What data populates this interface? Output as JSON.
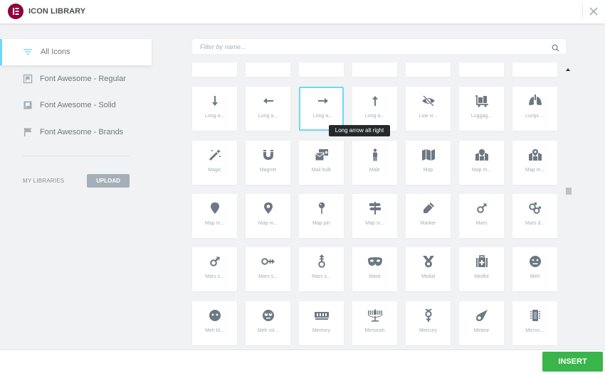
{
  "header": {
    "title": "ICON LIBRARY"
  },
  "sidebar": {
    "items": [
      {
        "label": "All Icons",
        "icon": "list-filter-icon",
        "active": true
      },
      {
        "label": "Font Awesome - Regular",
        "icon": "flag-regular-icon",
        "active": false
      },
      {
        "label": "Font Awesome - Solid",
        "icon": "flag-solid-icon",
        "active": false
      },
      {
        "label": "Font Awesome - Brands",
        "icon": "flag-brands-icon",
        "active": false
      }
    ],
    "my_libraries_label": "MY LIBRARIES",
    "upload_label": "UPLOAD"
  },
  "search": {
    "placeholder": "Filter by name...",
    "value": ""
  },
  "grid": {
    "rows": [
      [
        {
          "label": "Long a...",
          "icon": "long-arrow-down-icon",
          "glyph": "🠗"
        },
        {
          "label": "Long a...",
          "icon": "long-arrow-left-icon",
          "glyph": "🠔"
        },
        {
          "label": "Long a...",
          "icon": "long-arrow-right-icon",
          "glyph": "🠖",
          "selected": true
        },
        {
          "label": "Long a...",
          "icon": "long-arrow-up-icon",
          "glyph": "🠕"
        },
        {
          "label": "Low vi...",
          "icon": "low-vision-icon",
          "glyph": ""
        },
        {
          "label": "Luggag...",
          "icon": "luggage-cart-icon",
          "glyph": ""
        },
        {
          "label": "Lungs ...",
          "icon": "lungs-virus-icon",
          "glyph": ""
        }
      ],
      [
        {
          "label": "Magic",
          "icon": "magic-wand-icon",
          "glyph": ""
        },
        {
          "label": "Magnet",
          "icon": "magnet-icon",
          "glyph": ""
        },
        {
          "label": "Mail bulk",
          "icon": "mail-bulk-icon",
          "glyph": ""
        },
        {
          "label": "Male",
          "icon": "male-icon",
          "glyph": ""
        },
        {
          "label": "Map",
          "icon": "map-icon",
          "glyph": ""
        },
        {
          "label": "Map m...",
          "icon": "map-marked-icon",
          "glyph": ""
        },
        {
          "label": "Map m...",
          "icon": "map-marked-alt-icon",
          "glyph": ""
        }
      ],
      [
        {
          "label": "Map m...",
          "icon": "map-marker-icon",
          "glyph": ""
        },
        {
          "label": "Map m...",
          "icon": "map-marker-alt-icon",
          "glyph": ""
        },
        {
          "label": "Map pin",
          "icon": "map-pin-icon",
          "glyph": ""
        },
        {
          "label": "Map si...",
          "icon": "map-signs-icon",
          "glyph": ""
        },
        {
          "label": "Marker",
          "icon": "marker-icon",
          "glyph": ""
        },
        {
          "label": "Mars",
          "icon": "mars-icon",
          "glyph": "♂"
        },
        {
          "label": "Mars d...",
          "icon": "mars-double-icon",
          "glyph": "⚣"
        }
      ],
      [
        {
          "label": "Mars s...",
          "icon": "mars-stroke-icon",
          "glyph": "⚦"
        },
        {
          "label": "Mars s...",
          "icon": "mars-stroke-h-icon",
          "glyph": ""
        },
        {
          "label": "Mars s...",
          "icon": "mars-stroke-v-icon",
          "glyph": ""
        },
        {
          "label": "Mask",
          "icon": "mask-icon",
          "glyph": ""
        },
        {
          "label": "Medal",
          "icon": "medal-icon",
          "glyph": ""
        },
        {
          "label": "Medkit",
          "icon": "medkit-icon",
          "glyph": ""
        },
        {
          "label": "Meh",
          "icon": "meh-icon",
          "glyph": ""
        }
      ],
      [
        {
          "label": "Meh bl...",
          "icon": "meh-blank-icon",
          "glyph": ""
        },
        {
          "label": "Meh rol...",
          "icon": "meh-rolling-eyes-icon",
          "glyph": ""
        },
        {
          "label": "Memory",
          "icon": "memory-icon",
          "glyph": ""
        },
        {
          "label": "Menorah",
          "icon": "menorah-icon",
          "glyph": ""
        },
        {
          "label": "Mercury",
          "icon": "mercury-icon",
          "glyph": "☿"
        },
        {
          "label": "Meteor",
          "icon": "meteor-icon",
          "glyph": ""
        },
        {
          "label": "Microc...",
          "icon": "microchip-icon",
          "glyph": ""
        }
      ]
    ]
  },
  "tooltip": {
    "text": "Long arrow alt right"
  },
  "footer": {
    "insert_label": "INSERT"
  },
  "colors": {
    "accent": "#71d7f7",
    "brand": "#92003b",
    "insert": "#39b54a",
    "icon": "#6d7882"
  }
}
